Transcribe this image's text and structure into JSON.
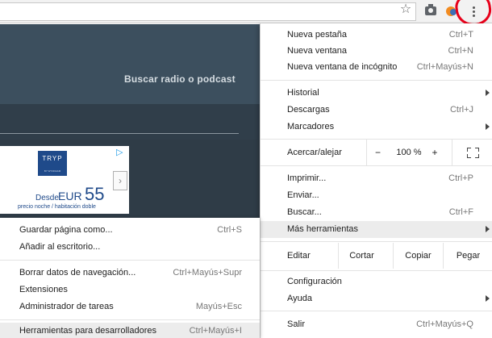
{
  "page": {
    "search_link": "Buscar radio o podcast"
  },
  "ad": {
    "logo_text": "TRYP",
    "logo_sub": "BY WYNDHAM",
    "desde": "Desde",
    "currency": "EUR",
    "price": "55",
    "fine_print": "precio noche / habitación doble",
    "next_arrow": "›",
    "choices_glyph": "▷"
  },
  "toolbar": {
    "star_glyph": "☆"
  },
  "menu": {
    "items_top": [
      {
        "label": "Nueva pestaña",
        "shortcut": "Ctrl+T"
      },
      {
        "label": "Nueva ventana",
        "shortcut": "Ctrl+N"
      },
      {
        "label": "Nueva ventana de incógnito",
        "shortcut": "Ctrl+Mayús+N"
      }
    ],
    "items_history": [
      {
        "label": "Historial",
        "shortcut": ""
      },
      {
        "label": "Descargas",
        "shortcut": "Ctrl+J"
      },
      {
        "label": "Marcadores",
        "shortcut": ""
      }
    ],
    "zoom": {
      "label": "Acercar/alejar",
      "minus": "−",
      "value": "100 %",
      "plus": "+"
    },
    "items_tools": [
      {
        "label": "Imprimir...",
        "shortcut": "Ctrl+P"
      },
      {
        "label": "Enviar...",
        "shortcut": ""
      },
      {
        "label": "Buscar...",
        "shortcut": "Ctrl+F"
      },
      {
        "label": "Más herramientas",
        "shortcut": ""
      }
    ],
    "edit": {
      "label": "Editar",
      "cut": "Cortar",
      "copy": "Copiar",
      "paste": "Pegar"
    },
    "items_settings": [
      {
        "label": "Configuración",
        "shortcut": ""
      },
      {
        "label": "Ayuda",
        "shortcut": ""
      }
    ],
    "exit": {
      "label": "Salir",
      "shortcut": "Ctrl+Mayús+Q"
    }
  },
  "submenu": {
    "items": [
      {
        "label": "Guardar página como...",
        "shortcut": "Ctrl+S"
      },
      {
        "label": "Añadir al escritorio...",
        "shortcut": ""
      },
      {
        "label": "Borrar datos de navegación...",
        "shortcut": "Ctrl+Mayús+Supr"
      },
      {
        "label": "Extensiones",
        "shortcut": ""
      },
      {
        "label": "Administrador de tareas",
        "shortcut": "Mayús+Esc"
      },
      {
        "label": "Herramientas para desarrolladores",
        "shortcut": "Ctrl+Mayús+I"
      }
    ]
  },
  "colors": {
    "header": "#3c4f5e",
    "annotation_red": "#e8001a",
    "hover": "#ececec"
  }
}
